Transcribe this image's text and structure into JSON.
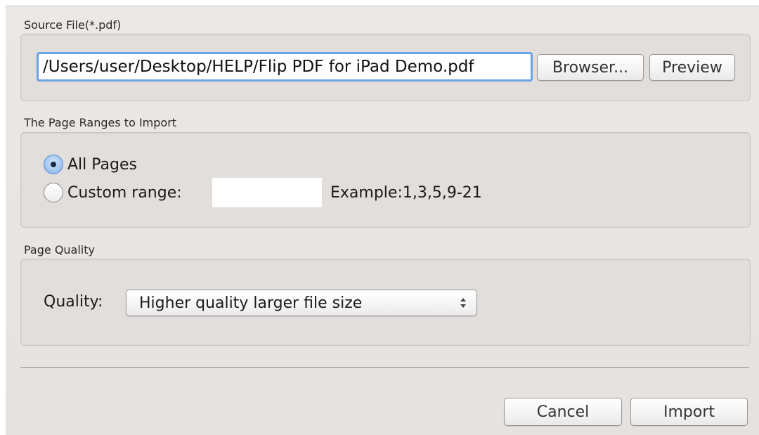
{
  "source_section": {
    "label": "Source File(*.pdf)",
    "file_path_value": "/Users/user/Desktop/HELP/Flip PDF for iPad Demo.pdf",
    "browse_label": "Browser...",
    "preview_label": "Preview"
  },
  "range_section": {
    "label": "The Page Ranges to Import",
    "all_pages_label": "All Pages",
    "custom_range_label": "Custom range:",
    "custom_range_value": "",
    "example_text": "Example:1,3,5,9-21",
    "selected": "all_pages"
  },
  "quality_section": {
    "label": "Page Quality",
    "quality_label": "Quality:",
    "quality_value": "Higher quality larger file size"
  },
  "footer": {
    "cancel_label": "Cancel",
    "import_label": "Import"
  },
  "colors": {
    "focus_ring": "#6aa3e6",
    "radio_selected": "#7eaee6",
    "dialog_bg": "#e8e5e3"
  }
}
